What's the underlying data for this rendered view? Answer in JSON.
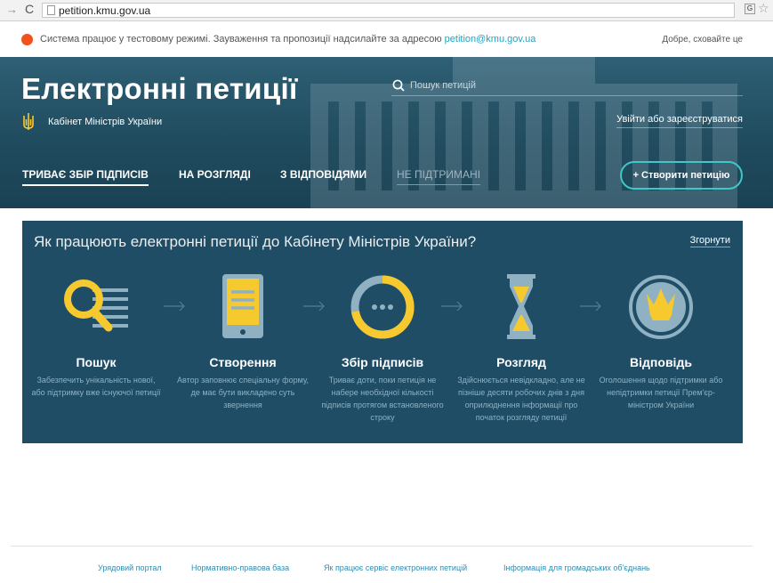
{
  "browser": {
    "url": "petition.kmu.gov.ua"
  },
  "notice": {
    "text": "Система працює у тестовому режимі. Зауваження та пропозиції надсилайте за адресою ",
    "email": "petition@kmu.gov.ua",
    "hide_label": "Добре, сховайте це"
  },
  "header": {
    "title": "Електронні петиції",
    "subtitle": "Кабінет Міністрів України",
    "search_placeholder": "Пошук петицій",
    "login_label": "Увійти або зареєструватися",
    "create_label": "+ Створити петицію",
    "tabs": [
      {
        "label": "ТРИВАЄ ЗБІР ПІДПИСІВ",
        "state": "active"
      },
      {
        "label": "НА РОЗГЛЯДІ",
        "state": "normal"
      },
      {
        "label": "З ВІДПОВІДЯМИ",
        "state": "normal"
      },
      {
        "label": "НЕ ПІДТРИМАНІ",
        "state": "inactive"
      }
    ]
  },
  "info_panel": {
    "title": "Як працюють електронні петиції до Кабінету Міністрів України?",
    "collapse_label": "Згорнути",
    "steps": [
      {
        "icon": "search-doc-icon",
        "title": "Пошук",
        "desc": "Забезпечить унікальність нової, або підтримку вже існуючої петиції"
      },
      {
        "icon": "tablet-icon",
        "title": "Створення",
        "desc": "Автор заповнює спеціальну форму, де має бути викладено суть звернення"
      },
      {
        "icon": "progress-ring-icon",
        "title": "Збір підписів",
        "desc": "Триває доти, поки петиція не набере необхідної кількості підписів протягом встановленого строку"
      },
      {
        "icon": "hourglass-icon",
        "title": "Розгляд",
        "desc": "Здійснюється невідкладно, але не пізніше десяти робочих днів з дня оприлюднення інформації про початок розгляду петиції"
      },
      {
        "icon": "trident-badge-icon",
        "title": "Відповідь",
        "desc": "Оголошення щодо підтримки або непідтримки петиції Прем'єр-міністром України"
      }
    ]
  },
  "footer": {
    "links": [
      "Урядовий портал",
      "Нормативно-правова база",
      "Як працює сервіс електронних петицій",
      "Інформація для громадських об'єднань"
    ]
  },
  "colors": {
    "notice_dot": "#f2501d",
    "hero_bg": "#1f4a5d",
    "panel_bg": "#1f4d66",
    "accent_yellow": "#f6c92e",
    "create_border": "#3fc7c9",
    "link_blue": "#2f8cb1"
  }
}
